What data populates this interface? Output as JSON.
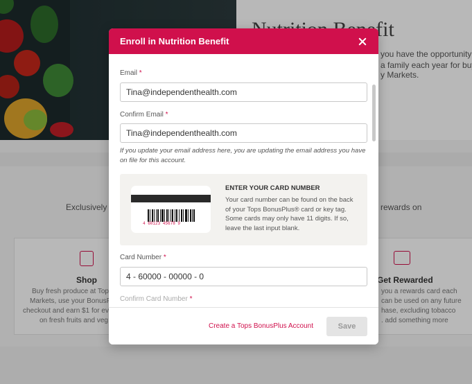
{
  "background": {
    "title": "Nutrition Benefit",
    "line1": "you have the opportunity",
    "line2": "a family each year for buy",
    "line3": "y Markets.",
    "exclusively": "Exclusively f",
    "rewards": "rewards on",
    "shop": {
      "heading": "Shop",
      "lines": [
        "Buy fresh produce at Top",
        "Markets, use your BonusPl",
        "checkout and earn $1 for ev",
        "on fresh fruits and veg"
      ]
    },
    "get_rewarded": {
      "heading": "Get Rewarded",
      "lines": [
        "you a rewards card each",
        "can be used on any future",
        "hase, excluding tobacco",
        ". add something more"
      ]
    }
  },
  "modal": {
    "title": "Enroll in Nutrition Benefit",
    "email": {
      "label": "Email",
      "required_mark": "*",
      "value": "Tina@independenthealth.com"
    },
    "confirm_email": {
      "label": "Confirm Email",
      "required_mark": "*",
      "value": "Tina@independenthealth.com"
    },
    "note": "If you update your email address here, you are updating the email address you have on file for this account.",
    "card_info": {
      "heading": "ENTER YOUR CARD NUMBER",
      "text": "Your card number can be found on the back of your Tops BonusPlus® card or key tag. Some cards may only have 11 digits. If so, leave the last input blank.",
      "barcode_number": "4  60123  45678  9"
    },
    "card_number": {
      "label": "Card Number",
      "required_mark": "*",
      "value": "4 - 60000 - 00000 - 0"
    },
    "confirm_card_number": {
      "label": "Confirm Card Number",
      "required_mark": "*"
    },
    "footer": {
      "link_label": "Create a Tops BonusPlus Account",
      "save_label": "Save"
    }
  },
  "colors": {
    "accent": "#d0104c",
    "disabled_button": "#e4e4e4"
  }
}
